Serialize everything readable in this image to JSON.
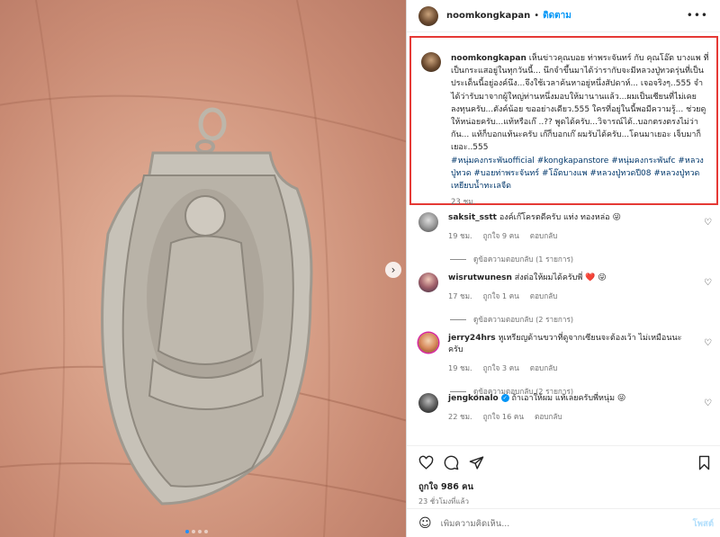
{
  "post": {
    "username": "noomkongkapan",
    "follow_label": "ติดตาม",
    "more_label": "•••",
    "caption": {
      "username": "noomkongkapan",
      "text": "เห็นข่าวคุณบอย ท่าพระจันทร์ กับ คุณโอ๊ต บางแพ ที่เป็นกระแสอยู่ในทุกวันนี้... นึกจำขึ้นมาได้ว่ารากับจะมีหลวงปู่ทวดรุ่นที่เป็นประเด็นนี้อยู่องค์นึง...จึงใช้เวลาค้นหาอยู่หนึ่งสัปดาห์... เจอจริงๆ..555 จำได้ว่ารับมาจากผู้ใหญ่ท่านหนึ่งมอบให้มานานแล้ว...ผมเป็นเซียนที่ไม่เคยลงทุนครับ...ตังค์น้อย ขออย่างเดียว.555 ใครที่อยู่ในนี้พอมีความรู้... ช่วยดูให้หน่อยครับ...แท้หรือเก๊ ..?? พูดได้ครับ...วิจารณ์ได้..บอกตรงตรงไม่ว่ากัน... แท้ก็บอกแท้นะครับ เก๊ก็บอกเก๊ ผมรับได้ครับ...โดนมาเยอะ เจ็บมาก็เยอะ..555",
      "tags": "#หนุ่มคงกระพันofficial #kongkapanstore #หนุ่มคงกระพันfc #หลวงปู่ทวด #บอยท่าพระจันทร์ #โอ๊ตบางแพ #หลวงปู่ทวดปี08 #หลวงปู่ทวดเหยียบน้ำทะเลจืด",
      "time": "23 ชม."
    },
    "comments": [
      {
        "username": "saksit_sstt",
        "text": "องค์เก๊โครตดีครับ แท่ง ทองหล่อ 😜",
        "time": "19 ชม.",
        "likes": "ถูกใจ 9 คน",
        "reply": "ตอบกลับ",
        "view_replies": "ดูข้อความตอบกลับ (1 รายการ)"
      },
      {
        "username": "wisrutwunesn",
        "text": "ส่งต่อให้ผมได้ครับพี่ ❤️ 😜",
        "time": "17 ชม.",
        "likes": "ถูกใจ 1 คน",
        "reply": "ตอบกลับ",
        "view_replies": "ดูข้อความตอบกลับ (2 รายการ)"
      },
      {
        "username": "jerry24hrs",
        "text": "หูเหรียญด้านขวาที่ดูจากเซียนจะต้องเว้า ไม่เหมือนนะครับ",
        "time": "19 ชม.",
        "likes": "ถูกใจ 3 คน",
        "reply": "ตอบกลับ",
        "view_replies": "ดูข้อความตอบกลับ (2 รายการ)"
      },
      {
        "username": "jengkonalo",
        "text": "ถ้าเอาให้ผม แท้เลยครับพี่หนุ่ม 😜",
        "time": "22 ชม.",
        "likes": "ถูกใจ 16 คน",
        "reply": "ตอบกลับ"
      }
    ],
    "likes": "ถูกใจ 986 คน",
    "posted_ago": "23 ชั่วโมงที่แล้ว",
    "add_comment_placeholder": "เพิ่มความคิดเห็น...",
    "post_label": "โพสต์",
    "carousel": {
      "total": 4,
      "current": 1
    },
    "icons": [
      "heart-icon",
      "comment-icon",
      "share-icon",
      "bookmark-icon",
      "emoji-icon",
      "chevron-right-icon"
    ],
    "colors": {
      "highlight_border": "#e53935",
      "link": "#0095f6",
      "hashtag": "#00376b"
    }
  }
}
